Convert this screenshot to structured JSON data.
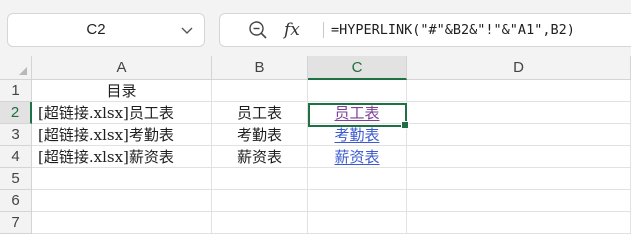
{
  "name_box": {
    "value": "C2"
  },
  "formula_bar": {
    "fx_label": "fx",
    "formula": "=HYPERLINK(\"#\"&B2&\"!\"&\"A1\",B2)"
  },
  "columns": [
    {
      "label": "A"
    },
    {
      "label": "B"
    },
    {
      "label": "C"
    },
    {
      "label": "D"
    }
  ],
  "rows": [
    {
      "label": "1",
      "cells": [
        "目录",
        "",
        "",
        ""
      ]
    },
    {
      "label": "2",
      "cells": [
        "[超链接.xlsx]员工表",
        "员工表",
        "员工表",
        ""
      ]
    },
    {
      "label": "3",
      "cells": [
        "[超链接.xlsx]考勤表",
        "考勤表",
        "考勤表",
        ""
      ]
    },
    {
      "label": "4",
      "cells": [
        "[超链接.xlsx]薪资表",
        "薪资表",
        "薪资表",
        ""
      ]
    },
    {
      "label": "5",
      "cells": [
        "",
        "",
        "",
        ""
      ]
    },
    {
      "label": "6",
      "cells": [
        "",
        "",
        "",
        ""
      ]
    },
    {
      "label": "7",
      "cells": [
        "",
        "",
        "",
        ""
      ]
    }
  ],
  "selection": {
    "column": "C",
    "row": "2"
  },
  "colors": {
    "accent": "#1e7145",
    "link": "#3c5bd1",
    "visited_link": "#7d3f98"
  },
  "icons": {
    "name_box_dropdown": "chevron-down-icon",
    "zoom": "zoom-out-icon",
    "function": "fx-icon",
    "select_all": "select-all-corner-icon"
  }
}
